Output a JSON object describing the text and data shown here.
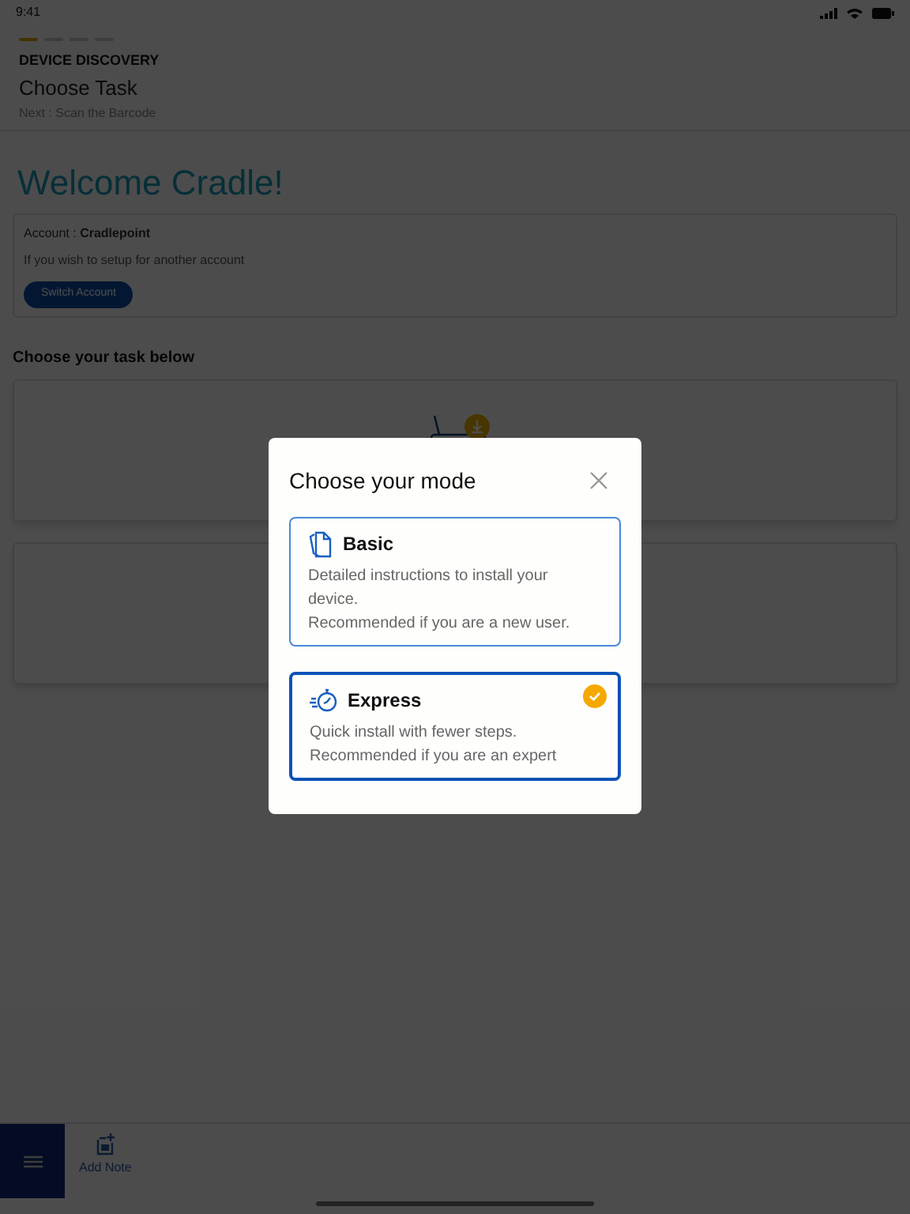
{
  "status_bar": {
    "time": "9:41"
  },
  "progress": [
    {
      "selected": true
    },
    {
      "selected": false
    },
    {
      "selected": false
    },
    {
      "selected": false
    }
  ],
  "header": {
    "section": "DEVICE DISCOVERY",
    "title": "Choose Task",
    "next": "Next : Scan the Barcode"
  },
  "welcome": "Welcome Cradle!",
  "account": {
    "line": "Account : **Cradlepoint**",
    "hint": "If you wish to setup for another account",
    "button": "Switch Account"
  },
  "tasks_heading": "Choose your task below",
  "dialog": {
    "title": "Choose your mode",
    "modes": [
      {
        "kind": "basic",
        "title": "Basic",
        "lines": [
          "Detailed instructions to install your device.",
          "Recommended if you are a new user."
        ],
        "selected": false
      },
      {
        "kind": "express",
        "title": "Express",
        "lines": [
          "Quick install with fewer steps.",
          "Recommended if you are an expert"
        ],
        "selected": true
      }
    ]
  },
  "bottom_bar": {
    "action": "Add Note"
  }
}
